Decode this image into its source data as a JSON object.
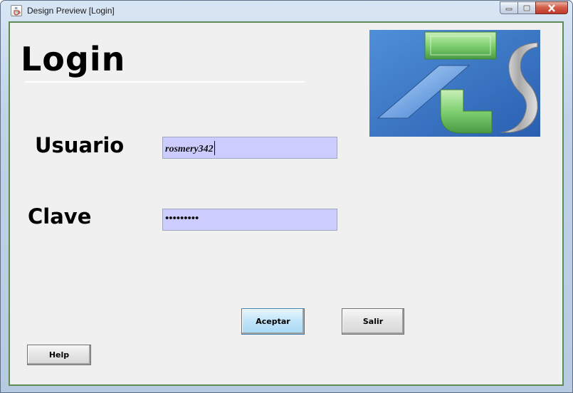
{
  "window": {
    "title": "Design Preview [Login]",
    "icon": "java-cup-icon",
    "controls": [
      "minimize-icon",
      "maximize-icon",
      "close-icon"
    ]
  },
  "form": {
    "heading": "Login",
    "logo_icon": "zs-logo",
    "username": {
      "label": "Usuario",
      "value": "rosmery342"
    },
    "password": {
      "label": "Clave",
      "masked_value": "•••••••••"
    },
    "buttons": {
      "accept": "Aceptar",
      "exit": "Salir",
      "help": "Help"
    }
  },
  "colors": {
    "field_background": "#ccccff",
    "client_background": "#f0f0f0",
    "frame_border": "#5e8c55"
  }
}
